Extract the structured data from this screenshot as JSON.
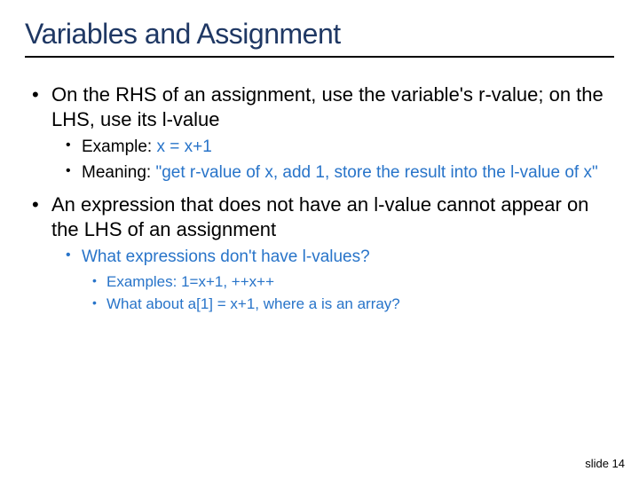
{
  "title": "Variables and Assignment",
  "b1": {
    "text": "On the RHS of an assignment, use the variable's r-value; on the LHS, use its l-value",
    "sub": {
      "s1a": "Example: ",
      "s1b": "x = x+1",
      "s2a": "Meaning: ",
      "s2b": "\"get r-value of x, add 1, store the result into the l-value of x\""
    }
  },
  "b2": {
    "text": "An expression that does not have an l-value cannot appear on the LHS of an assignment",
    "sub": {
      "q": "What expressions don't have l-values?",
      "ex_a": "Examples: ",
      "ex_b": "1=x+1, ++x++",
      "wa_a": "What about ",
      "wa_b": "a[1] = x+1",
      "wa_c": ", where a is an array?"
    }
  },
  "footer": "slide 14"
}
